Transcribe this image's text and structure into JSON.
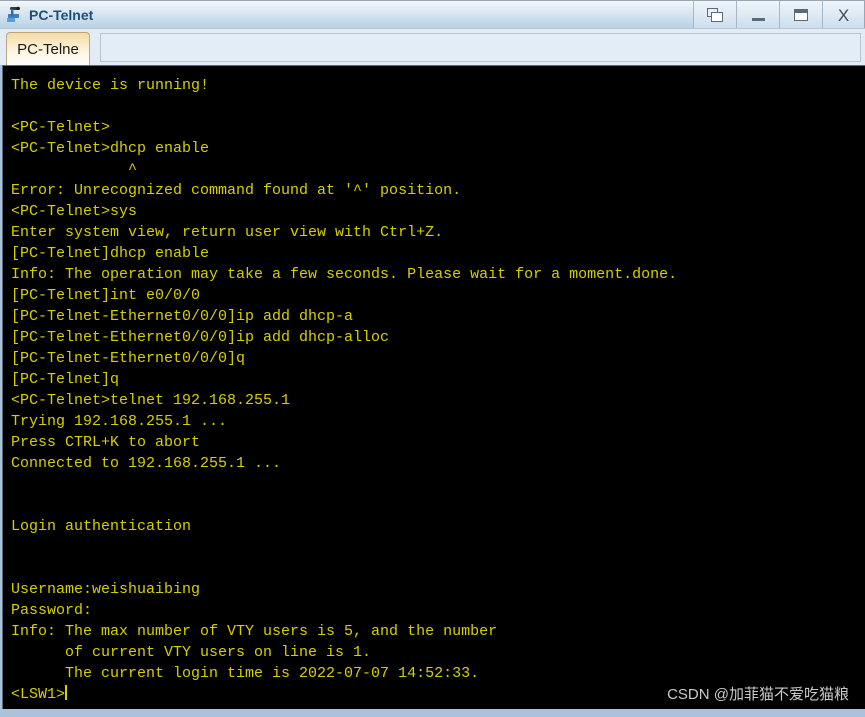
{
  "window": {
    "title": "PC-Telnet",
    "app_icon": "pc-device-icon",
    "controls": [
      {
        "name": "restore-windows-button",
        "icon": "restore-windows-icon",
        "label": ""
      },
      {
        "name": "minimize-button",
        "icon": "minimize-icon",
        "label": ""
      },
      {
        "name": "maximize-button",
        "icon": "maximize-icon",
        "label": ""
      },
      {
        "name": "close-button",
        "icon": "close-icon",
        "label": "X"
      }
    ]
  },
  "tabs": {
    "active_index": 0,
    "items": [
      {
        "label": "PC-Telne"
      }
    ]
  },
  "terminal": {
    "foreground_color": "#d6cf00",
    "background_color": "#000000",
    "prompt": "<LSW1>",
    "lines": [
      "The device is running!",
      "",
      "<PC-Telnet>",
      "<PC-Telnet>dhcp enable",
      "             ^",
      "Error: Unrecognized command found at '^' position.",
      "<PC-Telnet>sys",
      "Enter system view, return user view with Ctrl+Z.",
      "[PC-Telnet]dhcp enable",
      "Info: The operation may take a few seconds. Please wait for a moment.done.",
      "[PC-Telnet]int e0/0/0",
      "[PC-Telnet-Ethernet0/0/0]ip add dhcp-a",
      "[PC-Telnet-Ethernet0/0/0]ip add dhcp-alloc",
      "[PC-Telnet-Ethernet0/0/0]q",
      "[PC-Telnet]q",
      "<PC-Telnet>telnet 192.168.255.1",
      "Trying 192.168.255.1 ...",
      "Press CTRL+K to abort",
      "Connected to 192.168.255.1 ...",
      "",
      "",
      "Login authentication",
      "",
      "",
      "Username:weishuaibing",
      "Password:",
      "Info: The max number of VTY users is 5, and the number",
      "      of current VTY users on line is 1.",
      "      The current login time is 2022-07-07 14:52:33."
    ]
  },
  "watermark": {
    "text": "CSDN @加菲猫不爱吃猫粮"
  }
}
